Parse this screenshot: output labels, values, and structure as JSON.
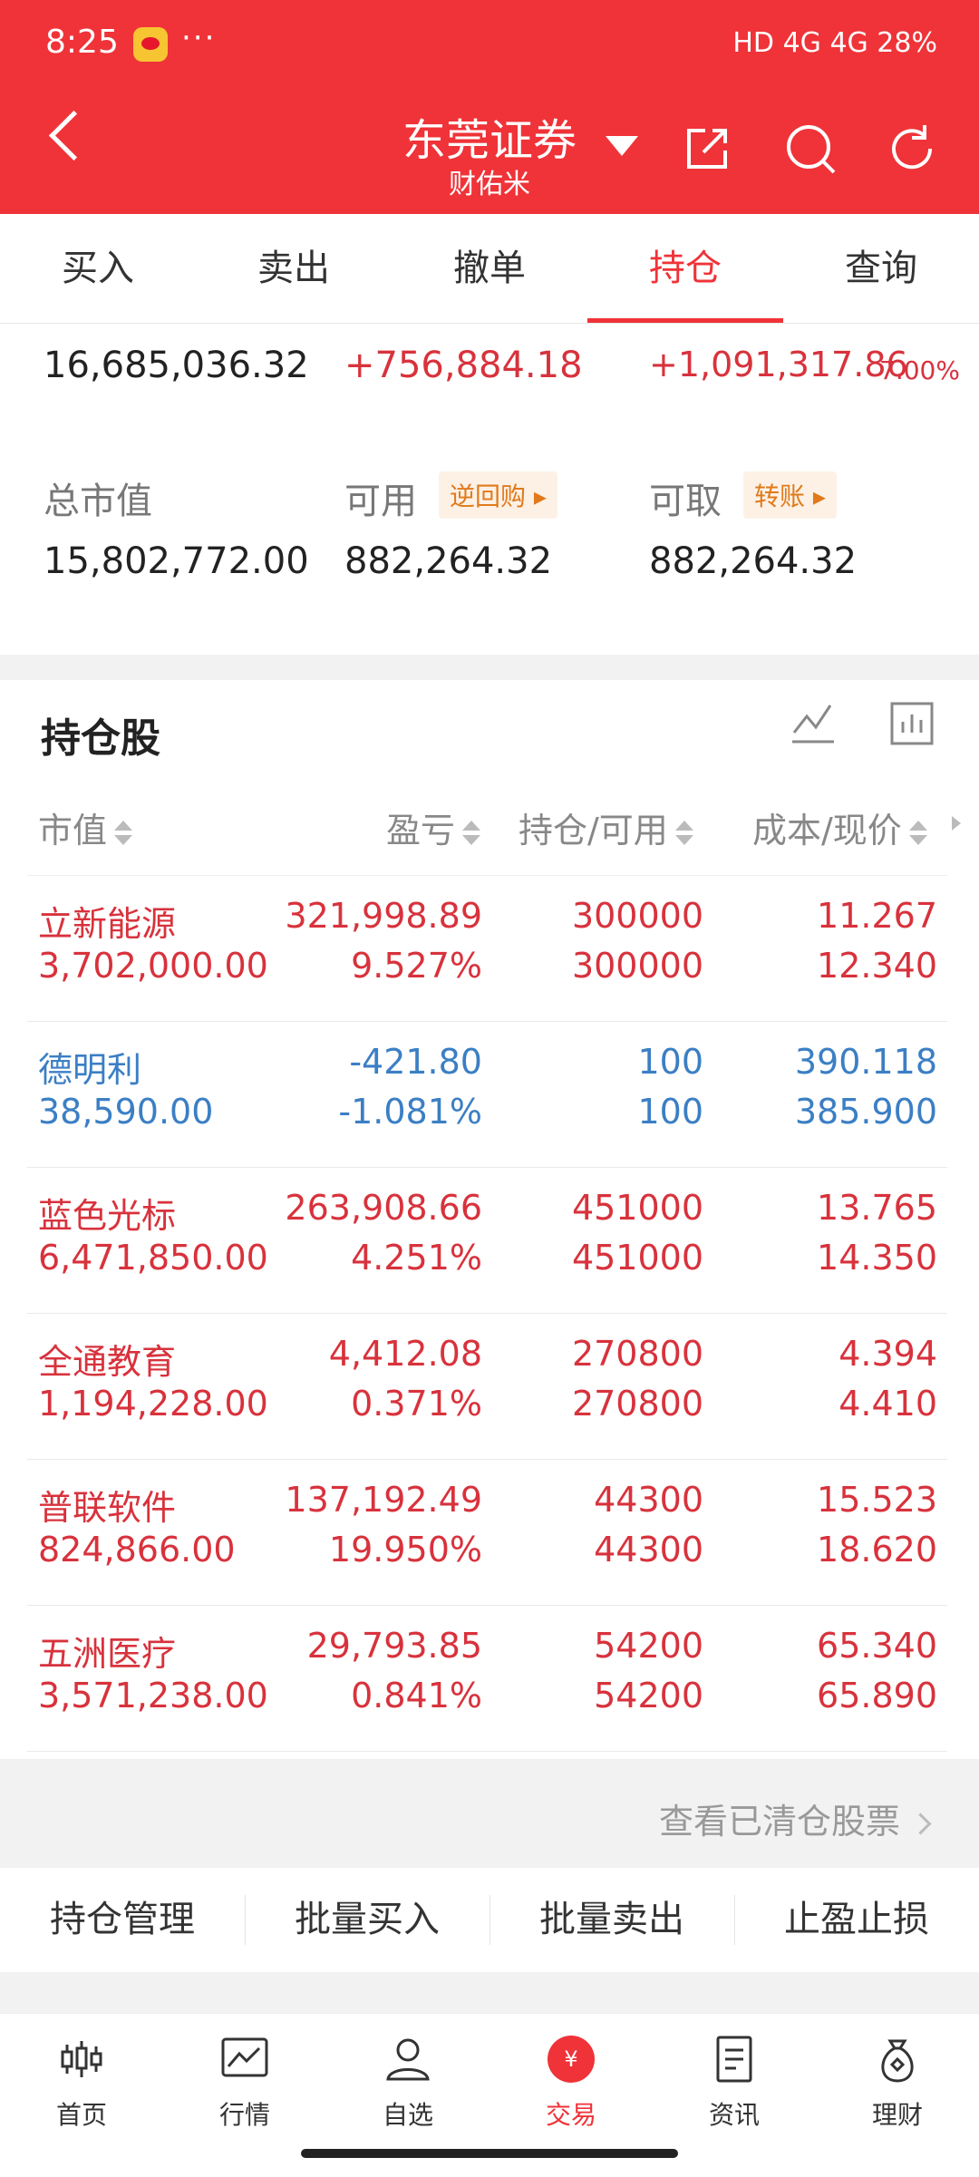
{
  "status": {
    "time": "8:25",
    "dots": "···",
    "right": "HD 4G 4G 28%"
  },
  "header": {
    "title": "东莞证券",
    "subtitle": "财佑米"
  },
  "tabs": [
    "买入",
    "卖出",
    "撤单",
    "持仓",
    "查询"
  ],
  "active_tab": "持仓",
  "summary": {
    "total_assets": "16,685,036.32",
    "daily_pnl": "+756,884.18",
    "total_pnl": "+1,091,317.86",
    "total_pnl_pct": "7.00%",
    "market_value_label": "总市值",
    "market_value": "15,802,772.00",
    "available_label": "可用",
    "available_badge": "逆回购",
    "available": "882,264.32",
    "withdrawable_label": "可取",
    "withdrawable_badge": "转账",
    "withdrawable": "882,264.32"
  },
  "holdings": {
    "title": "持仓股",
    "headers": [
      "市值",
      "盈亏",
      "持仓/可用",
      "成本/现价"
    ],
    "rows": [
      {
        "name": "立新能源",
        "value": "3,702,000.00",
        "pnl": "321,998.89",
        "pnl_pct": "9.527%",
        "hold": "300000",
        "avail": "300000",
        "cost": "11.267",
        "price": "12.340",
        "color": "#d8323c"
      },
      {
        "name": "德明利",
        "value": "38,590.00",
        "pnl": "-421.80",
        "pnl_pct": "-1.081%",
        "hold": "100",
        "avail": "100",
        "cost": "390.118",
        "price": "385.900",
        "color": "#3b7fc4"
      },
      {
        "name": "蓝色光标",
        "value": "6,471,850.00",
        "pnl": "263,908.66",
        "pnl_pct": "4.251%",
        "hold": "451000",
        "avail": "451000",
        "cost": "13.765",
        "price": "14.350",
        "color": "#d8323c"
      },
      {
        "name": "全通教育",
        "value": "1,194,228.00",
        "pnl": "4,412.08",
        "pnl_pct": "0.371%",
        "hold": "270800",
        "avail": "270800",
        "cost": "4.394",
        "price": "4.410",
        "color": "#d8323c"
      },
      {
        "name": "普联软件",
        "value": "824,866.00",
        "pnl": "137,192.49",
        "pnl_pct": "19.950%",
        "hold": "44300",
        "avail": "44300",
        "cost": "15.523",
        "price": "18.620",
        "color": "#d8323c"
      },
      {
        "name": "五洲医疗",
        "value": "3,571,238.00",
        "pnl": "29,793.85",
        "pnl_pct": "0.841%",
        "hold": "54200",
        "avail": "54200",
        "cost": "65.340",
        "price": "65.890",
        "color": "#d8323c"
      }
    ],
    "view_cleared": "查看已清仓股票"
  },
  "actions": [
    "持仓管理",
    "批量买入",
    "批量卖出",
    "止盈止损"
  ],
  "bottom_nav": [
    {
      "label": "首页",
      "icon": "candlestick-icon"
    },
    {
      "label": "行情",
      "icon": "chart-icon"
    },
    {
      "label": "自选",
      "icon": "user-icon"
    },
    {
      "label": "交易",
      "icon": "yuan-icon"
    },
    {
      "label": "资讯",
      "icon": "document-icon"
    },
    {
      "label": "理财",
      "icon": "money-bag-icon"
    }
  ],
  "active_nav": "交易",
  "colors": {
    "brand": "#ef3338",
    "gain": "#d8323c",
    "loss": "#3b7fc4",
    "badge": "#e07a1b"
  }
}
